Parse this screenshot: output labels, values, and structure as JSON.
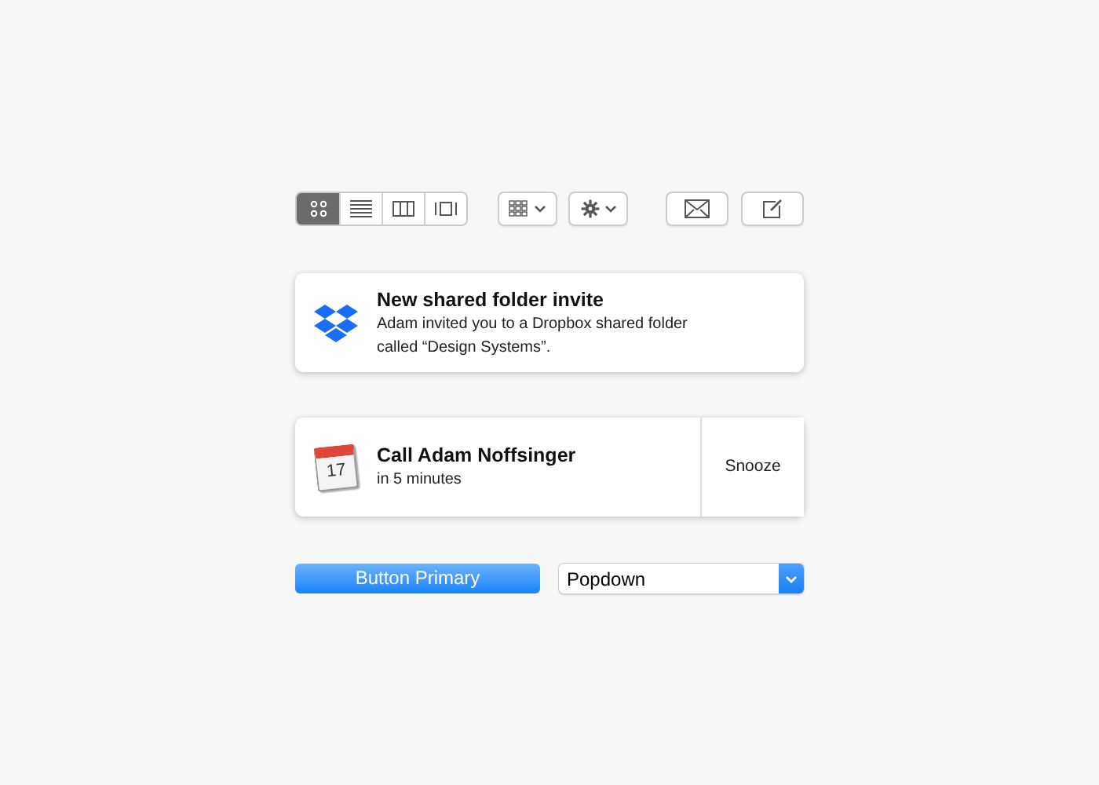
{
  "toolbar": {
    "view_segments": [
      {
        "kind": "icons",
        "selected": true
      },
      {
        "kind": "list",
        "selected": false
      },
      {
        "kind": "columns",
        "selected": false
      },
      {
        "kind": "gallery",
        "selected": false
      }
    ],
    "menus": [
      {
        "kind": "grid"
      },
      {
        "kind": "gear"
      }
    ],
    "actions": [
      {
        "kind": "mail"
      },
      {
        "kind": "compose"
      }
    ]
  },
  "notifications": [
    {
      "kind": "dropbox",
      "title": "New shared folder invite",
      "body": "Adam invited you to a Dropbox shared folder called “Design Systems”."
    },
    {
      "kind": "calendar",
      "calendar_day": "17",
      "title": "Call Adam Noffsinger",
      "body": "in 5 minutes",
      "action": "Snooze"
    }
  ],
  "primary_button": "Button Primary",
  "popdown": {
    "value": "Popdown"
  }
}
